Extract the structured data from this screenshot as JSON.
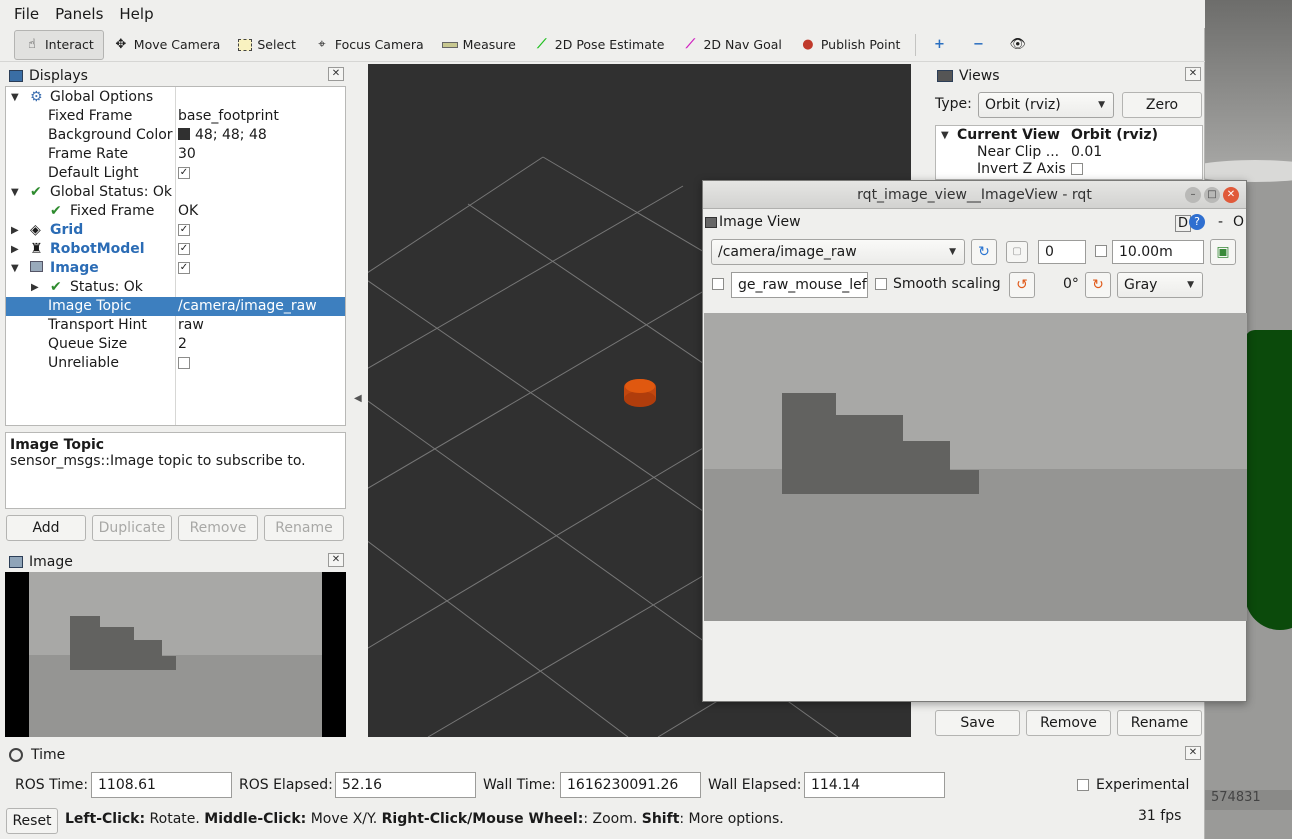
{
  "menu": {
    "file": "File",
    "panels": "Panels",
    "help": "Help"
  },
  "toolbar": {
    "interact": "Interact",
    "move_camera": "Move Camera",
    "select": "Select",
    "focus_camera": "Focus Camera",
    "measure": "Measure",
    "pose_estimate": "2D Pose Estimate",
    "nav_goal": "2D Nav Goal",
    "publish_point": "Publish Point"
  },
  "displays": {
    "title": "Displays",
    "rows": [
      {
        "key": "Global Options",
        "value": ""
      },
      {
        "key": "Fixed Frame",
        "value": "base_footprint"
      },
      {
        "key": "Background Color",
        "value": "48; 48; 48"
      },
      {
        "key": "Frame Rate",
        "value": "30"
      },
      {
        "key": "Default Light",
        "value": ""
      },
      {
        "key": "Global Status: Ok",
        "value": ""
      },
      {
        "key": "Fixed Frame",
        "value": "OK"
      },
      {
        "key": "Grid",
        "value": ""
      },
      {
        "key": "RobotModel",
        "value": ""
      },
      {
        "key": "Image",
        "value": ""
      },
      {
        "key": "Status: Ok",
        "value": ""
      },
      {
        "key": "Image Topic",
        "value": "/camera/image_raw"
      },
      {
        "key": "Transport Hint",
        "value": "raw"
      },
      {
        "key": "Queue Size",
        "value": "2"
      },
      {
        "key": "Unreliable",
        "value": ""
      }
    ],
    "desc_title": "Image Topic",
    "desc_text": "sensor_msgs::Image topic to subscribe to.",
    "buttons": {
      "add": "Add",
      "duplicate": "Duplicate",
      "remove": "Remove",
      "rename": "Rename"
    }
  },
  "image_panel": {
    "title": "Image"
  },
  "views": {
    "title": "Views",
    "type_label": "Type:",
    "type_value": "Orbit (rviz)",
    "zero": "Zero",
    "current_view": "Current View",
    "current_view_value": "Orbit (rviz)",
    "near_clip": "Near Clip ...",
    "near_clip_value": "0.01",
    "invert_z": "Invert Z Axis",
    "save": "Save",
    "remove": "Remove",
    "rename": "Rename"
  },
  "time": {
    "title": "Time",
    "ros_time_label": "ROS Time:",
    "ros_time": "1108.61",
    "ros_elapsed_label": "ROS Elapsed:",
    "ros_elapsed": "52.16",
    "wall_time_label": "Wall Time:",
    "wall_time": "1616230091.26",
    "wall_elapsed_label": "Wall Elapsed:",
    "wall_elapsed": "114.14",
    "experimental": "Experimental"
  },
  "statusbar": {
    "reset": "Reset",
    "h1": "Left-Click:",
    "t1": " Rotate. ",
    "h2": "Middle-Click:",
    "t2": " Move X/Y. ",
    "h3": "Right-Click/Mouse Wheel:",
    "t3": ": Zoom. ",
    "h4": "Shift",
    "t4": ": More options.",
    "fps": "31 fps"
  },
  "rqt": {
    "window_title": "rqt_image_view__ImageView - rqt",
    "plugin_title": "Image View",
    "topic": "/camera/image_raw",
    "spin_value": "0",
    "max_range": "10.00m",
    "mouse_topic": "ge_raw_mouse_left",
    "smooth_scaling": "Smooth scaling",
    "rotation": "0°",
    "color_scheme": "Gray",
    "plugin_d": "D",
    "plugin_dash": "-",
    "plugin_o": "O"
  },
  "background": {
    "partial_number": "574831"
  },
  "colors": {
    "viewport_bg": "#303030",
    "selection": "#3d7fbf",
    "robot": "#d35400"
  }
}
